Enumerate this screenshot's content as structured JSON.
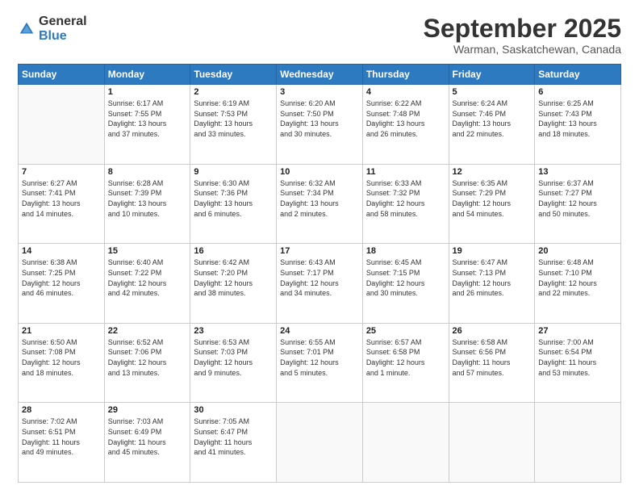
{
  "header": {
    "logo_general": "General",
    "logo_blue": "Blue",
    "month": "September 2025",
    "location": "Warman, Saskatchewan, Canada"
  },
  "weekdays": [
    "Sunday",
    "Monday",
    "Tuesday",
    "Wednesday",
    "Thursday",
    "Friday",
    "Saturday"
  ],
  "weeks": [
    [
      {
        "day": "",
        "info": ""
      },
      {
        "day": "1",
        "info": "Sunrise: 6:17 AM\nSunset: 7:55 PM\nDaylight: 13 hours\nand 37 minutes."
      },
      {
        "day": "2",
        "info": "Sunrise: 6:19 AM\nSunset: 7:53 PM\nDaylight: 13 hours\nand 33 minutes."
      },
      {
        "day": "3",
        "info": "Sunrise: 6:20 AM\nSunset: 7:50 PM\nDaylight: 13 hours\nand 30 minutes."
      },
      {
        "day": "4",
        "info": "Sunrise: 6:22 AM\nSunset: 7:48 PM\nDaylight: 13 hours\nand 26 minutes."
      },
      {
        "day": "5",
        "info": "Sunrise: 6:24 AM\nSunset: 7:46 PM\nDaylight: 13 hours\nand 22 minutes."
      },
      {
        "day": "6",
        "info": "Sunrise: 6:25 AM\nSunset: 7:43 PM\nDaylight: 13 hours\nand 18 minutes."
      }
    ],
    [
      {
        "day": "7",
        "info": "Sunrise: 6:27 AM\nSunset: 7:41 PM\nDaylight: 13 hours\nand 14 minutes."
      },
      {
        "day": "8",
        "info": "Sunrise: 6:28 AM\nSunset: 7:39 PM\nDaylight: 13 hours\nand 10 minutes."
      },
      {
        "day": "9",
        "info": "Sunrise: 6:30 AM\nSunset: 7:36 PM\nDaylight: 13 hours\nand 6 minutes."
      },
      {
        "day": "10",
        "info": "Sunrise: 6:32 AM\nSunset: 7:34 PM\nDaylight: 13 hours\nand 2 minutes."
      },
      {
        "day": "11",
        "info": "Sunrise: 6:33 AM\nSunset: 7:32 PM\nDaylight: 12 hours\nand 58 minutes."
      },
      {
        "day": "12",
        "info": "Sunrise: 6:35 AM\nSunset: 7:29 PM\nDaylight: 12 hours\nand 54 minutes."
      },
      {
        "day": "13",
        "info": "Sunrise: 6:37 AM\nSunset: 7:27 PM\nDaylight: 12 hours\nand 50 minutes."
      }
    ],
    [
      {
        "day": "14",
        "info": "Sunrise: 6:38 AM\nSunset: 7:25 PM\nDaylight: 12 hours\nand 46 minutes."
      },
      {
        "day": "15",
        "info": "Sunrise: 6:40 AM\nSunset: 7:22 PM\nDaylight: 12 hours\nand 42 minutes."
      },
      {
        "day": "16",
        "info": "Sunrise: 6:42 AM\nSunset: 7:20 PM\nDaylight: 12 hours\nand 38 minutes."
      },
      {
        "day": "17",
        "info": "Sunrise: 6:43 AM\nSunset: 7:17 PM\nDaylight: 12 hours\nand 34 minutes."
      },
      {
        "day": "18",
        "info": "Sunrise: 6:45 AM\nSunset: 7:15 PM\nDaylight: 12 hours\nand 30 minutes."
      },
      {
        "day": "19",
        "info": "Sunrise: 6:47 AM\nSunset: 7:13 PM\nDaylight: 12 hours\nand 26 minutes."
      },
      {
        "day": "20",
        "info": "Sunrise: 6:48 AM\nSunset: 7:10 PM\nDaylight: 12 hours\nand 22 minutes."
      }
    ],
    [
      {
        "day": "21",
        "info": "Sunrise: 6:50 AM\nSunset: 7:08 PM\nDaylight: 12 hours\nand 18 minutes."
      },
      {
        "day": "22",
        "info": "Sunrise: 6:52 AM\nSunset: 7:06 PM\nDaylight: 12 hours\nand 13 minutes."
      },
      {
        "day": "23",
        "info": "Sunrise: 6:53 AM\nSunset: 7:03 PM\nDaylight: 12 hours\nand 9 minutes."
      },
      {
        "day": "24",
        "info": "Sunrise: 6:55 AM\nSunset: 7:01 PM\nDaylight: 12 hours\nand 5 minutes."
      },
      {
        "day": "25",
        "info": "Sunrise: 6:57 AM\nSunset: 6:58 PM\nDaylight: 12 hours\nand 1 minute."
      },
      {
        "day": "26",
        "info": "Sunrise: 6:58 AM\nSunset: 6:56 PM\nDaylight: 11 hours\nand 57 minutes."
      },
      {
        "day": "27",
        "info": "Sunrise: 7:00 AM\nSunset: 6:54 PM\nDaylight: 11 hours\nand 53 minutes."
      }
    ],
    [
      {
        "day": "28",
        "info": "Sunrise: 7:02 AM\nSunset: 6:51 PM\nDaylight: 11 hours\nand 49 minutes."
      },
      {
        "day": "29",
        "info": "Sunrise: 7:03 AM\nSunset: 6:49 PM\nDaylight: 11 hours\nand 45 minutes."
      },
      {
        "day": "30",
        "info": "Sunrise: 7:05 AM\nSunset: 6:47 PM\nDaylight: 11 hours\nand 41 minutes."
      },
      {
        "day": "",
        "info": ""
      },
      {
        "day": "",
        "info": ""
      },
      {
        "day": "",
        "info": ""
      },
      {
        "day": "",
        "info": ""
      }
    ]
  ]
}
